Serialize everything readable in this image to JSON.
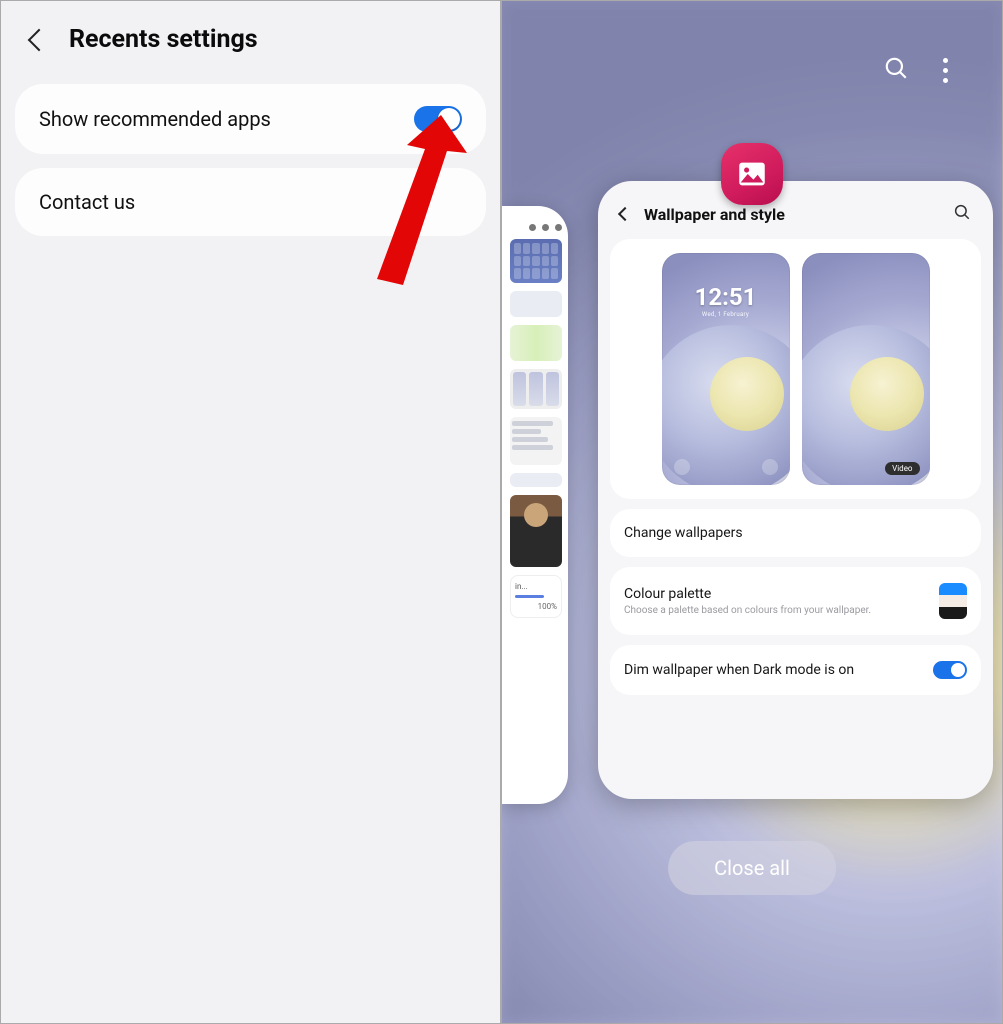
{
  "left": {
    "title": "Recents settings",
    "show_recommended": "Show recommended apps",
    "contact_us": "Contact us"
  },
  "right": {
    "close_all": "Close all",
    "partial": {
      "download_label": "in...",
      "download_pct": "100%"
    },
    "card": {
      "title": "Wallpaper and style",
      "clock_time": "12:51",
      "clock_date": "Wed, 1 February",
      "video_badge": "Video",
      "change_wallpapers": "Change wallpapers",
      "colour_palette_title": "Colour palette",
      "colour_palette_sub": "Choose a palette based on colours from your wallpaper.",
      "dim_wallpaper": "Dim wallpaper when Dark mode is on"
    }
  }
}
